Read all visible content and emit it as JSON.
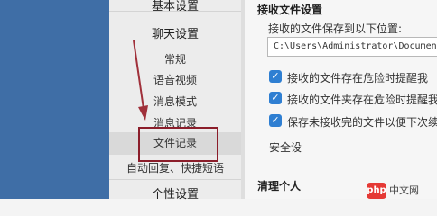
{
  "sidebar": {
    "header_basic": "基本设置",
    "header_chat": "聊天设置",
    "header_personal": "个性设置",
    "items": [
      "常规",
      "语音视频",
      "消息模式",
      "消息记录",
      "文件记录",
      "自动回复、快捷短语"
    ],
    "active_item": "文件记录"
  },
  "content": {
    "section_title": "接收文件设置",
    "save_location_label": "接收的文件保存到以下位置:",
    "save_path": "C:\\Users\\Administrator\\Documents",
    "options": [
      {
        "label": "接收的文件存在危险时提醒我",
        "checked": true
      },
      {
        "label": "接收的文件夹存在危险时提醒我",
        "checked": true
      },
      {
        "label": "保存未接收完的文件以便下次续",
        "checked": true
      }
    ],
    "safety_label": "安全设",
    "clear_section_title": "清理个人"
  },
  "watermark": {
    "badge": "php",
    "text": "中文网"
  },
  "colors": {
    "accent": "#2f7fd2",
    "highlight": "#8b1d2a",
    "arrow": "#a0303a"
  }
}
